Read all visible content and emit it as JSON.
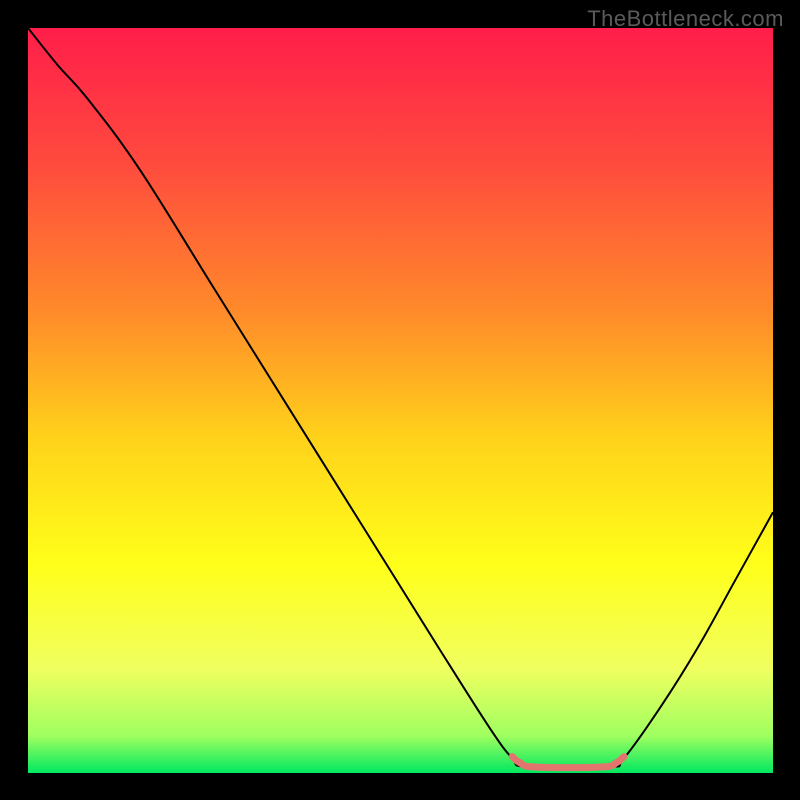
{
  "watermark": "TheBottleneck.com",
  "chart_data": {
    "type": "line",
    "title": "",
    "xlabel": "",
    "ylabel": "",
    "xlim": [
      0,
      100
    ],
    "ylim": [
      0,
      100
    ],
    "gradient_stops": [
      {
        "offset": 0,
        "color": "#ff1e4a"
      },
      {
        "offset": 18,
        "color": "#ff4a3e"
      },
      {
        "offset": 38,
        "color": "#ff8a2a"
      },
      {
        "offset": 55,
        "color": "#ffd21a"
      },
      {
        "offset": 72,
        "color": "#ffff1a"
      },
      {
        "offset": 86,
        "color": "#f0ff60"
      },
      {
        "offset": 95,
        "color": "#a0ff60"
      },
      {
        "offset": 100,
        "color": "#00e860"
      }
    ],
    "curve_points": [
      {
        "x": 0,
        "y": 100
      },
      {
        "x": 4,
        "y": 95
      },
      {
        "x": 8,
        "y": 90.5
      },
      {
        "x": 15,
        "y": 81
      },
      {
        "x": 25,
        "y": 65
      },
      {
        "x": 35,
        "y": 49
      },
      {
        "x": 45,
        "y": 33
      },
      {
        "x": 55,
        "y": 17
      },
      {
        "x": 62,
        "y": 6
      },
      {
        "x": 65,
        "y": 2
      },
      {
        "x": 67,
        "y": 0.8
      },
      {
        "x": 78,
        "y": 0.8
      },
      {
        "x": 80,
        "y": 2
      },
      {
        "x": 85,
        "y": 9
      },
      {
        "x": 90,
        "y": 17
      },
      {
        "x": 95,
        "y": 26
      },
      {
        "x": 100,
        "y": 35
      }
    ],
    "optimal_segment": {
      "color": "#e2766e",
      "points": [
        {
          "x": 65,
          "y": 2.2
        },
        {
          "x": 66,
          "y": 1.4
        },
        {
          "x": 68,
          "y": 0.8
        },
        {
          "x": 77,
          "y": 0.8
        },
        {
          "x": 79,
          "y": 1.4
        },
        {
          "x": 80,
          "y": 2.2
        }
      ]
    }
  }
}
